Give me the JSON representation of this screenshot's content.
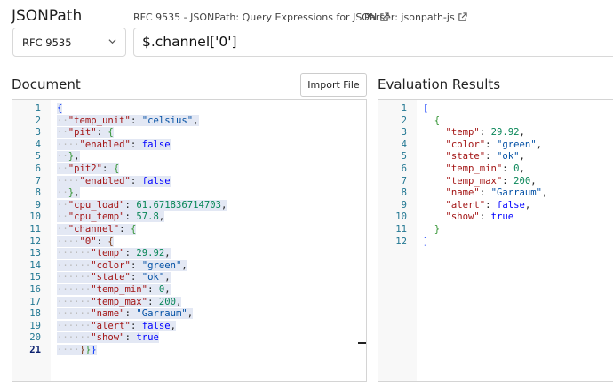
{
  "header": {
    "app_title": "JSONPath",
    "spec_link": "RFC 9535 - JSONPath: Query Expressions for JSON",
    "parser_link": "Parser: jsonpath-js"
  },
  "query": {
    "spec_select": "RFC 9535",
    "expression": "$.channel['0']"
  },
  "document": {
    "heading": "Document",
    "import_button": "Import File",
    "line_numbers": [
      "1",
      "2",
      "3",
      "4",
      "5",
      "6",
      "7",
      "8",
      "9",
      "10",
      "11",
      "12",
      "13",
      "14",
      "15",
      "16",
      "17",
      "18",
      "19",
      "20",
      "21"
    ],
    "current_line": "21"
  },
  "results": {
    "heading": "Evaluation Results",
    "line_numbers": [
      "1",
      "2",
      "3",
      "4",
      "5",
      "6",
      "7",
      "8",
      "9",
      "10",
      "11",
      "12"
    ]
  },
  "colors": {
    "line_number": "#237893",
    "key": "#a31515",
    "string": "#0451a5",
    "number": "#098658",
    "keyword": "#0000ff",
    "selection": "#e3e8f4"
  },
  "icons": [
    "external-link-icon",
    "chevron-down-icon"
  ]
}
